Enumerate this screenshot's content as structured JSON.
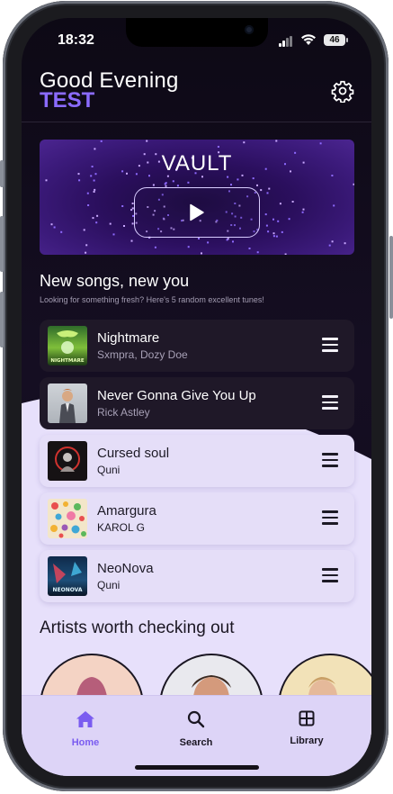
{
  "status_bar": {
    "time": "18:32",
    "battery": "46"
  },
  "header": {
    "greeting": "Good Evening",
    "username": "TEST"
  },
  "vault": {
    "title": "VAULT"
  },
  "new_songs": {
    "title": "New songs, new you",
    "subtitle": "Looking for something fresh? Here's 5 random excellent tunes!",
    "songs": [
      {
        "title": "Nightmare",
        "artist": "Sxmpra, Dozy Doe",
        "cover_text": "NIGHTMARE"
      },
      {
        "title": "Never Gonna Give You Up",
        "artist": "Rick Astley"
      },
      {
        "title": "Cursed soul",
        "artist": "Quni"
      },
      {
        "title": "Amargura",
        "artist": "KAROL G"
      },
      {
        "title": "NeoNova",
        "artist": "Quni",
        "cover_text": "NEONOVA"
      }
    ]
  },
  "artists": {
    "title": "Artists worth checking out"
  },
  "tabs": [
    {
      "label": "Home",
      "icon": "home-icon",
      "active": true
    },
    {
      "label": "Search",
      "icon": "search-icon",
      "active": false
    },
    {
      "label": "Library",
      "icon": "library-icon",
      "active": false
    }
  ],
  "colors": {
    "accent": "#8b6bff",
    "tab_active": "#7a5cf0",
    "light_surface": "#e5def8",
    "dark_surface": "#1f1828"
  }
}
